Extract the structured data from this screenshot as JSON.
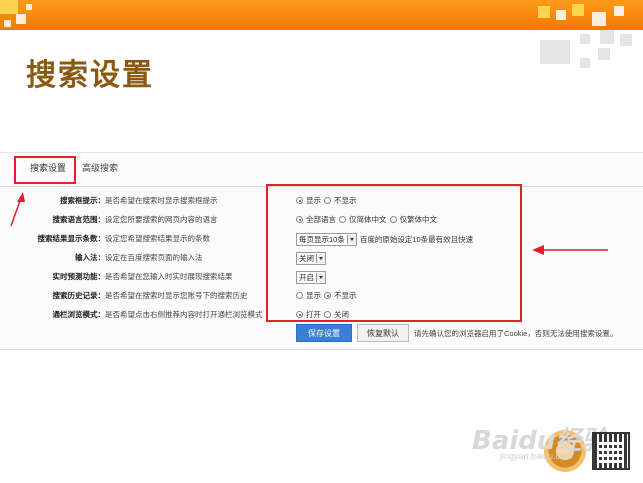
{
  "slide": {
    "title": "搜索设置"
  },
  "tabs": [
    {
      "label": "搜索设置",
      "active": true
    },
    {
      "label": "高级搜索",
      "active": false
    }
  ],
  "settings": [
    {
      "label": "搜索框提示：",
      "description": "是否希望在搜索时显示搜索框提示",
      "control": "radio",
      "options": [
        "显示",
        "不显示"
      ],
      "selected": 0
    },
    {
      "label": "搜索语言范围：",
      "description": "设定您所要搜索的网页内容的语言",
      "control": "radio",
      "options": [
        "全部语言",
        "仅简体中文",
        "仅繁体中文"
      ],
      "selected": 0
    },
    {
      "label": "搜索结果显示条数：",
      "description": "设定您希望搜索结果显示的条数",
      "control": "select",
      "value": "每页显示10条",
      "suffix": "百度的原始设定10条最有效且快速"
    },
    {
      "label": "输入法：",
      "description": "设定在百度搜索页面的输入法",
      "control": "select",
      "value": "关闭"
    },
    {
      "label": "实时预测功能：",
      "description": "是否希望在您输入时实时展现搜索结果",
      "control": "select",
      "value": "开启"
    },
    {
      "label": "搜索历史记录：",
      "description": "是否希望在搜索时显示您账号下的搜索历史",
      "control": "radio",
      "options": [
        "显示",
        "不显示"
      ],
      "selected": 1
    },
    {
      "label": "通栏浏览模式：",
      "description": "是否希望点击右侧推荐内容时打开通栏浏览模式",
      "control": "radio",
      "options": [
        "打开",
        "关闭"
      ],
      "selected": 0
    }
  ],
  "buttons": {
    "save": "保存设置",
    "reset": "恢复默认"
  },
  "note": "请先确认您的浏览器启用了Cookie，否则无法使用搜索设置。",
  "watermark": {
    "text": "Baidu经验",
    "sub": "jingyan.baidu.com"
  },
  "colors": {
    "accent_orange": "#f27a00",
    "highlight_red": "#e2202b",
    "title_brown": "#8a5a12",
    "save_blue": "#3a7fd6"
  }
}
